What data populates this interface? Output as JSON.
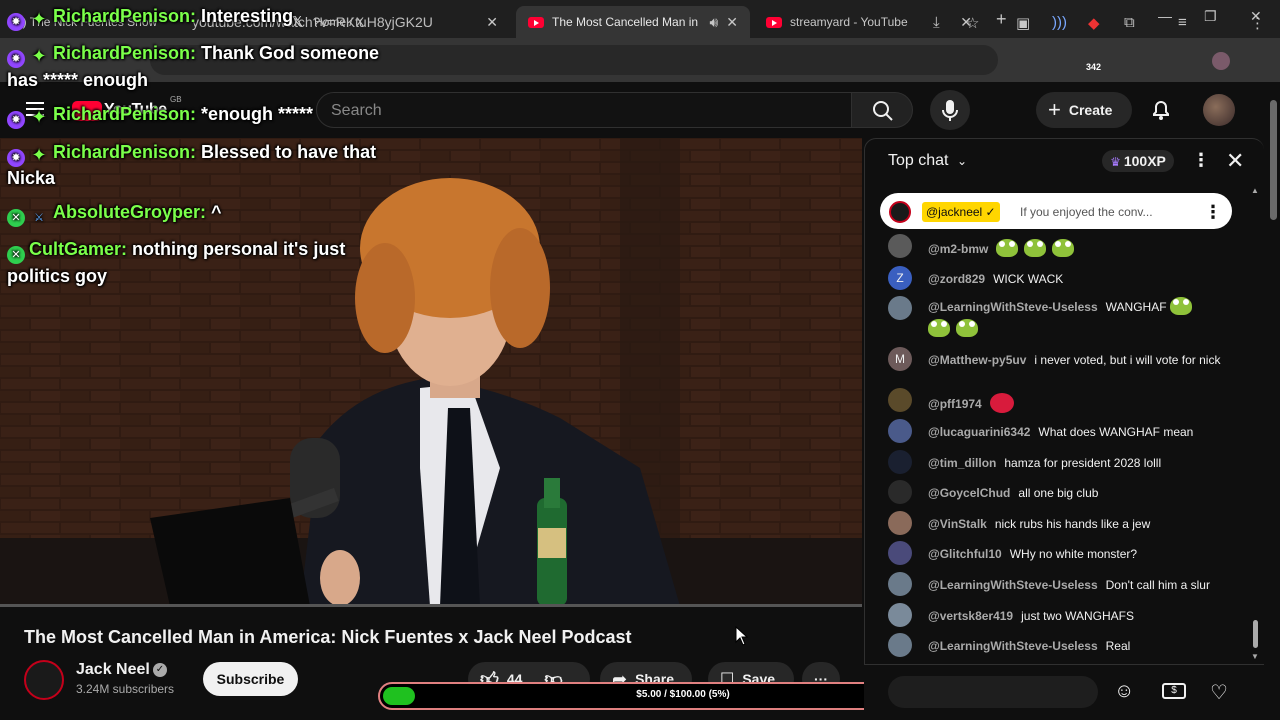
{
  "browser": {
    "tabs": [
      {
        "label": "(3) The Nick Fuentes Show",
        "active": false
      },
      {
        "label": "Home / X",
        "active": false
      },
      {
        "label": "The Most Cancelled Man in",
        "active": true
      },
      {
        "label": "streamyard - YouTube",
        "active": false
      }
    ],
    "url": "youtube.com/watch?v=RKtuH8yjGK2U",
    "extension_badge": "342",
    "window_controls": {
      "minimize": "—",
      "maximize": "❐",
      "close": "✕"
    },
    "new_tab": "+"
  },
  "youtube": {
    "logo_text": "YouTube",
    "logo_region": "GB",
    "search_placeholder": "Search",
    "create_label": "Create"
  },
  "overlay_chat": [
    {
      "badge": "purple",
      "name": "RichardPenison:",
      "text": "Interesting"
    },
    {
      "badge": "purple",
      "name": "RichardPenison:",
      "text": "Thank God someone",
      "cont": "has ***** enough"
    },
    {
      "badge": "purple",
      "name": "RichardPenison:",
      "text": "*enough *****"
    },
    {
      "badge": "purple",
      "name": "RichardPenison:",
      "text": "Blessed to have that",
      "cont": "Nicka"
    },
    {
      "badge": "green",
      "name": "AbsoluteGroyper:",
      "text": "^"
    },
    {
      "badge": "green",
      "name": "CultGamer:",
      "text": "nothing personal it's just",
      "cont": "politics goy"
    }
  ],
  "video": {
    "title": "The Most Cancelled Man in America: Nick Fuentes x Jack Neel Podcast",
    "channel_name": "Jack Neel",
    "subscribers": "3.24M subscribers",
    "subscribe_label": "Subscribe",
    "likes": "44",
    "share_label": "Share",
    "save_label": "Save",
    "more_label": "···"
  },
  "donation": {
    "text": "$5.00 / $100.00 (5%)",
    "progress": 0.05
  },
  "chat": {
    "header": "Top chat",
    "xp": "100XP",
    "pinned": {
      "author": "@jackneel",
      "text": "If you enjoyed the conv..."
    },
    "messages": [
      {
        "author": "@m2-bmw",
        "text": "",
        "frogs": 3
      },
      {
        "author": "@zord829",
        "text": "WICK WACK",
        "avatar_letter": "Z"
      },
      {
        "author": "@LearningWithSteve-Useless",
        "text": "WANGHAF",
        "frogs": 3
      },
      {
        "author": "@Matthew-py5uv",
        "text": "i never voted, but i will vote for nick",
        "avatar_letter": "M"
      },
      {
        "author": "@pff1974",
        "text": "",
        "lips": true
      },
      {
        "author": "@lucaguarini6342",
        "text": "What does WANGHAF mean"
      },
      {
        "author": "@tim_dillon",
        "text": "hamza for president 2028 lolll"
      },
      {
        "author": "@GoycelChud",
        "text": "all one big club"
      },
      {
        "author": "@VinStalk",
        "text": "nick rubs his hands like a jew"
      },
      {
        "author": "@Glitchful10",
        "text": "WHy no white monster?"
      },
      {
        "author": "@LearningWithSteve-Useless",
        "text": "Don't call him a slur"
      },
      {
        "author": "@vertsk8er419",
        "text": "just two WANGHAFS"
      },
      {
        "author": "@LearningWithSteve-Useless",
        "text": "Real"
      }
    ]
  },
  "colors": {
    "accent_red": "#ff0033",
    "overlay_name_green": "#7bff4a",
    "donation_fill": "#1fc11f",
    "pinned_badge": "#ffd600"
  }
}
